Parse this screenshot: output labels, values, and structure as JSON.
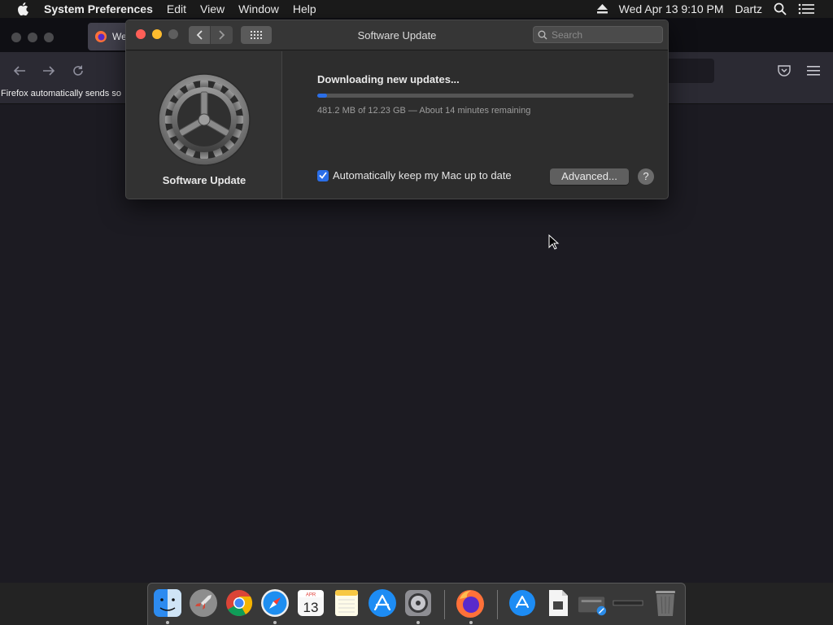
{
  "menubar": {
    "app_name": "System Preferences",
    "items": [
      "Edit",
      "View",
      "Window",
      "Help"
    ],
    "clock": "Wed Apr 13  9:10 PM",
    "user": "Dartz"
  },
  "firefox": {
    "tab_title": "We",
    "notice": "Firefox automatically sends so"
  },
  "window": {
    "title": "Software Update",
    "search_placeholder": "Search"
  },
  "sidebar": {
    "label": "Software Update"
  },
  "update": {
    "status": "Downloading new updates...",
    "progress_fraction": 0.03,
    "progress_text": "481.2 MB of 12.23 GB — About 14 minutes remaining",
    "auto_update_label": "Automatically keep my Mac up to date",
    "auto_update_checked": true,
    "advanced_label": "Advanced...",
    "help_label": "?"
  },
  "calendar_icon": {
    "month": "APR",
    "day": "13"
  },
  "colors": {
    "accent": "#2a6ee8",
    "close": "#ff5f57",
    "minimize": "#febc2e"
  }
}
